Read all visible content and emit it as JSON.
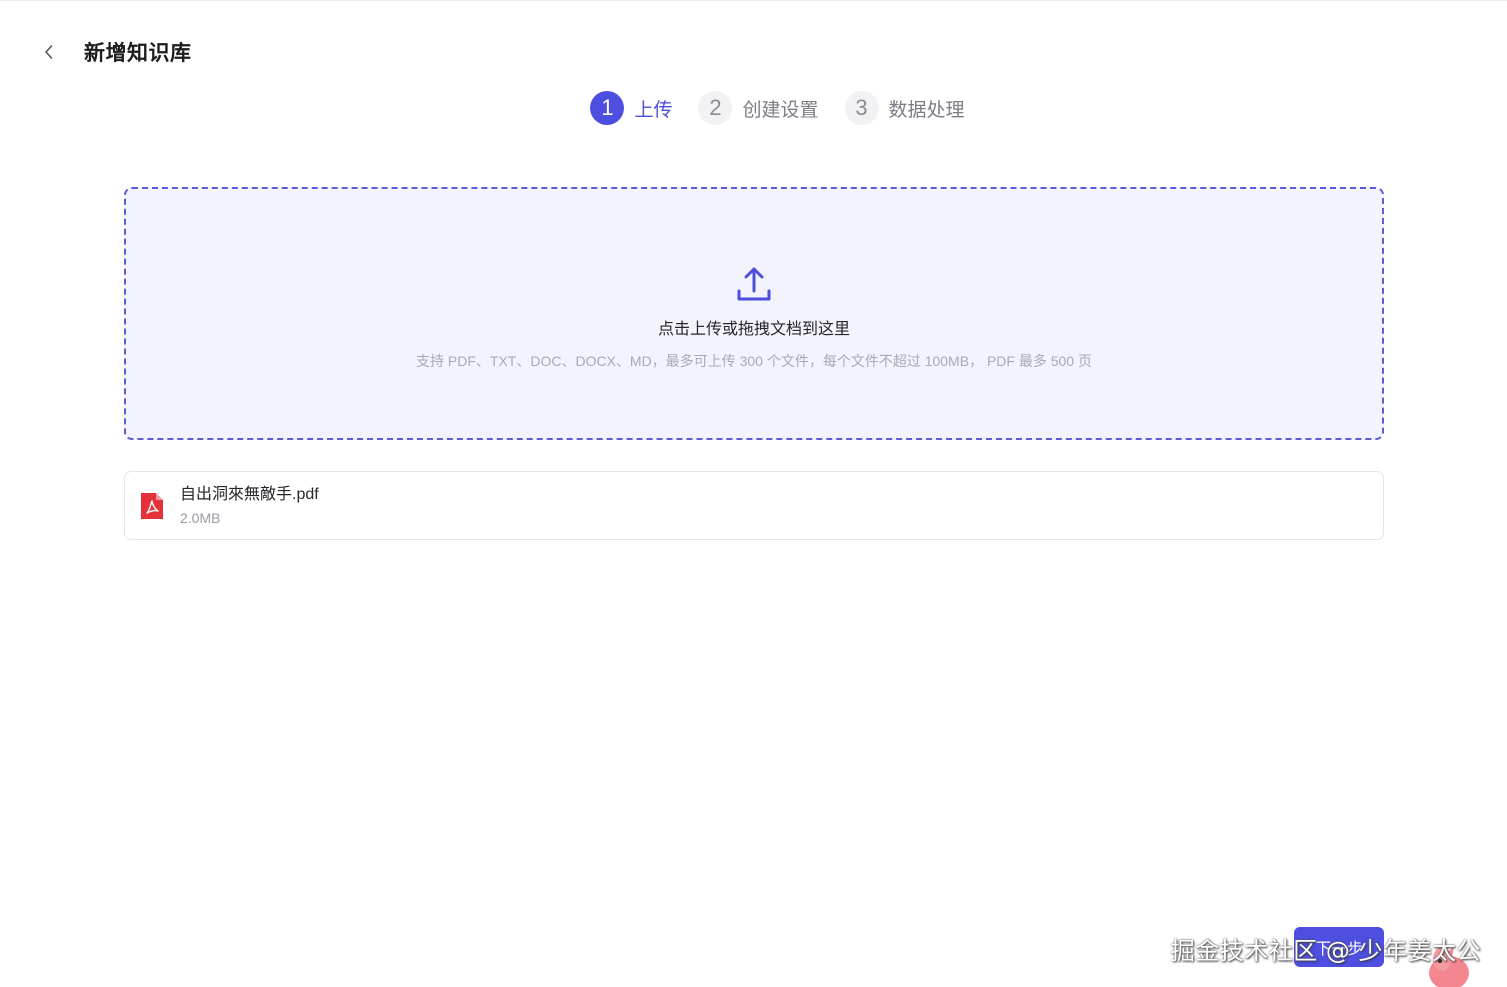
{
  "header": {
    "title": "新增知识库"
  },
  "steps": [
    {
      "num": "1",
      "label": "上传",
      "active": true
    },
    {
      "num": "2",
      "label": "创建设置",
      "active": false
    },
    {
      "num": "3",
      "label": "数据处理",
      "active": false
    }
  ],
  "dropzone": {
    "title": "点击上传或拖拽文档到这里",
    "hint": "支持 PDF、TXT、DOC、DOCX、MD，最多可上传 300 个文件，每个文件不超过 100MB， PDF 最多 500 页"
  },
  "files": [
    {
      "name": "自出洞來無敵手.pdf",
      "size": "2.0MB",
      "icon": "pdf-icon"
    }
  ],
  "footer": {
    "next_label": "下一步"
  },
  "watermark": "掘金技术社区 @ 少年姜太公",
  "colors": {
    "accent": "#4e4fe0",
    "dropzone_bg": "#f3f3fd",
    "pdf_red": "#e5323a"
  }
}
